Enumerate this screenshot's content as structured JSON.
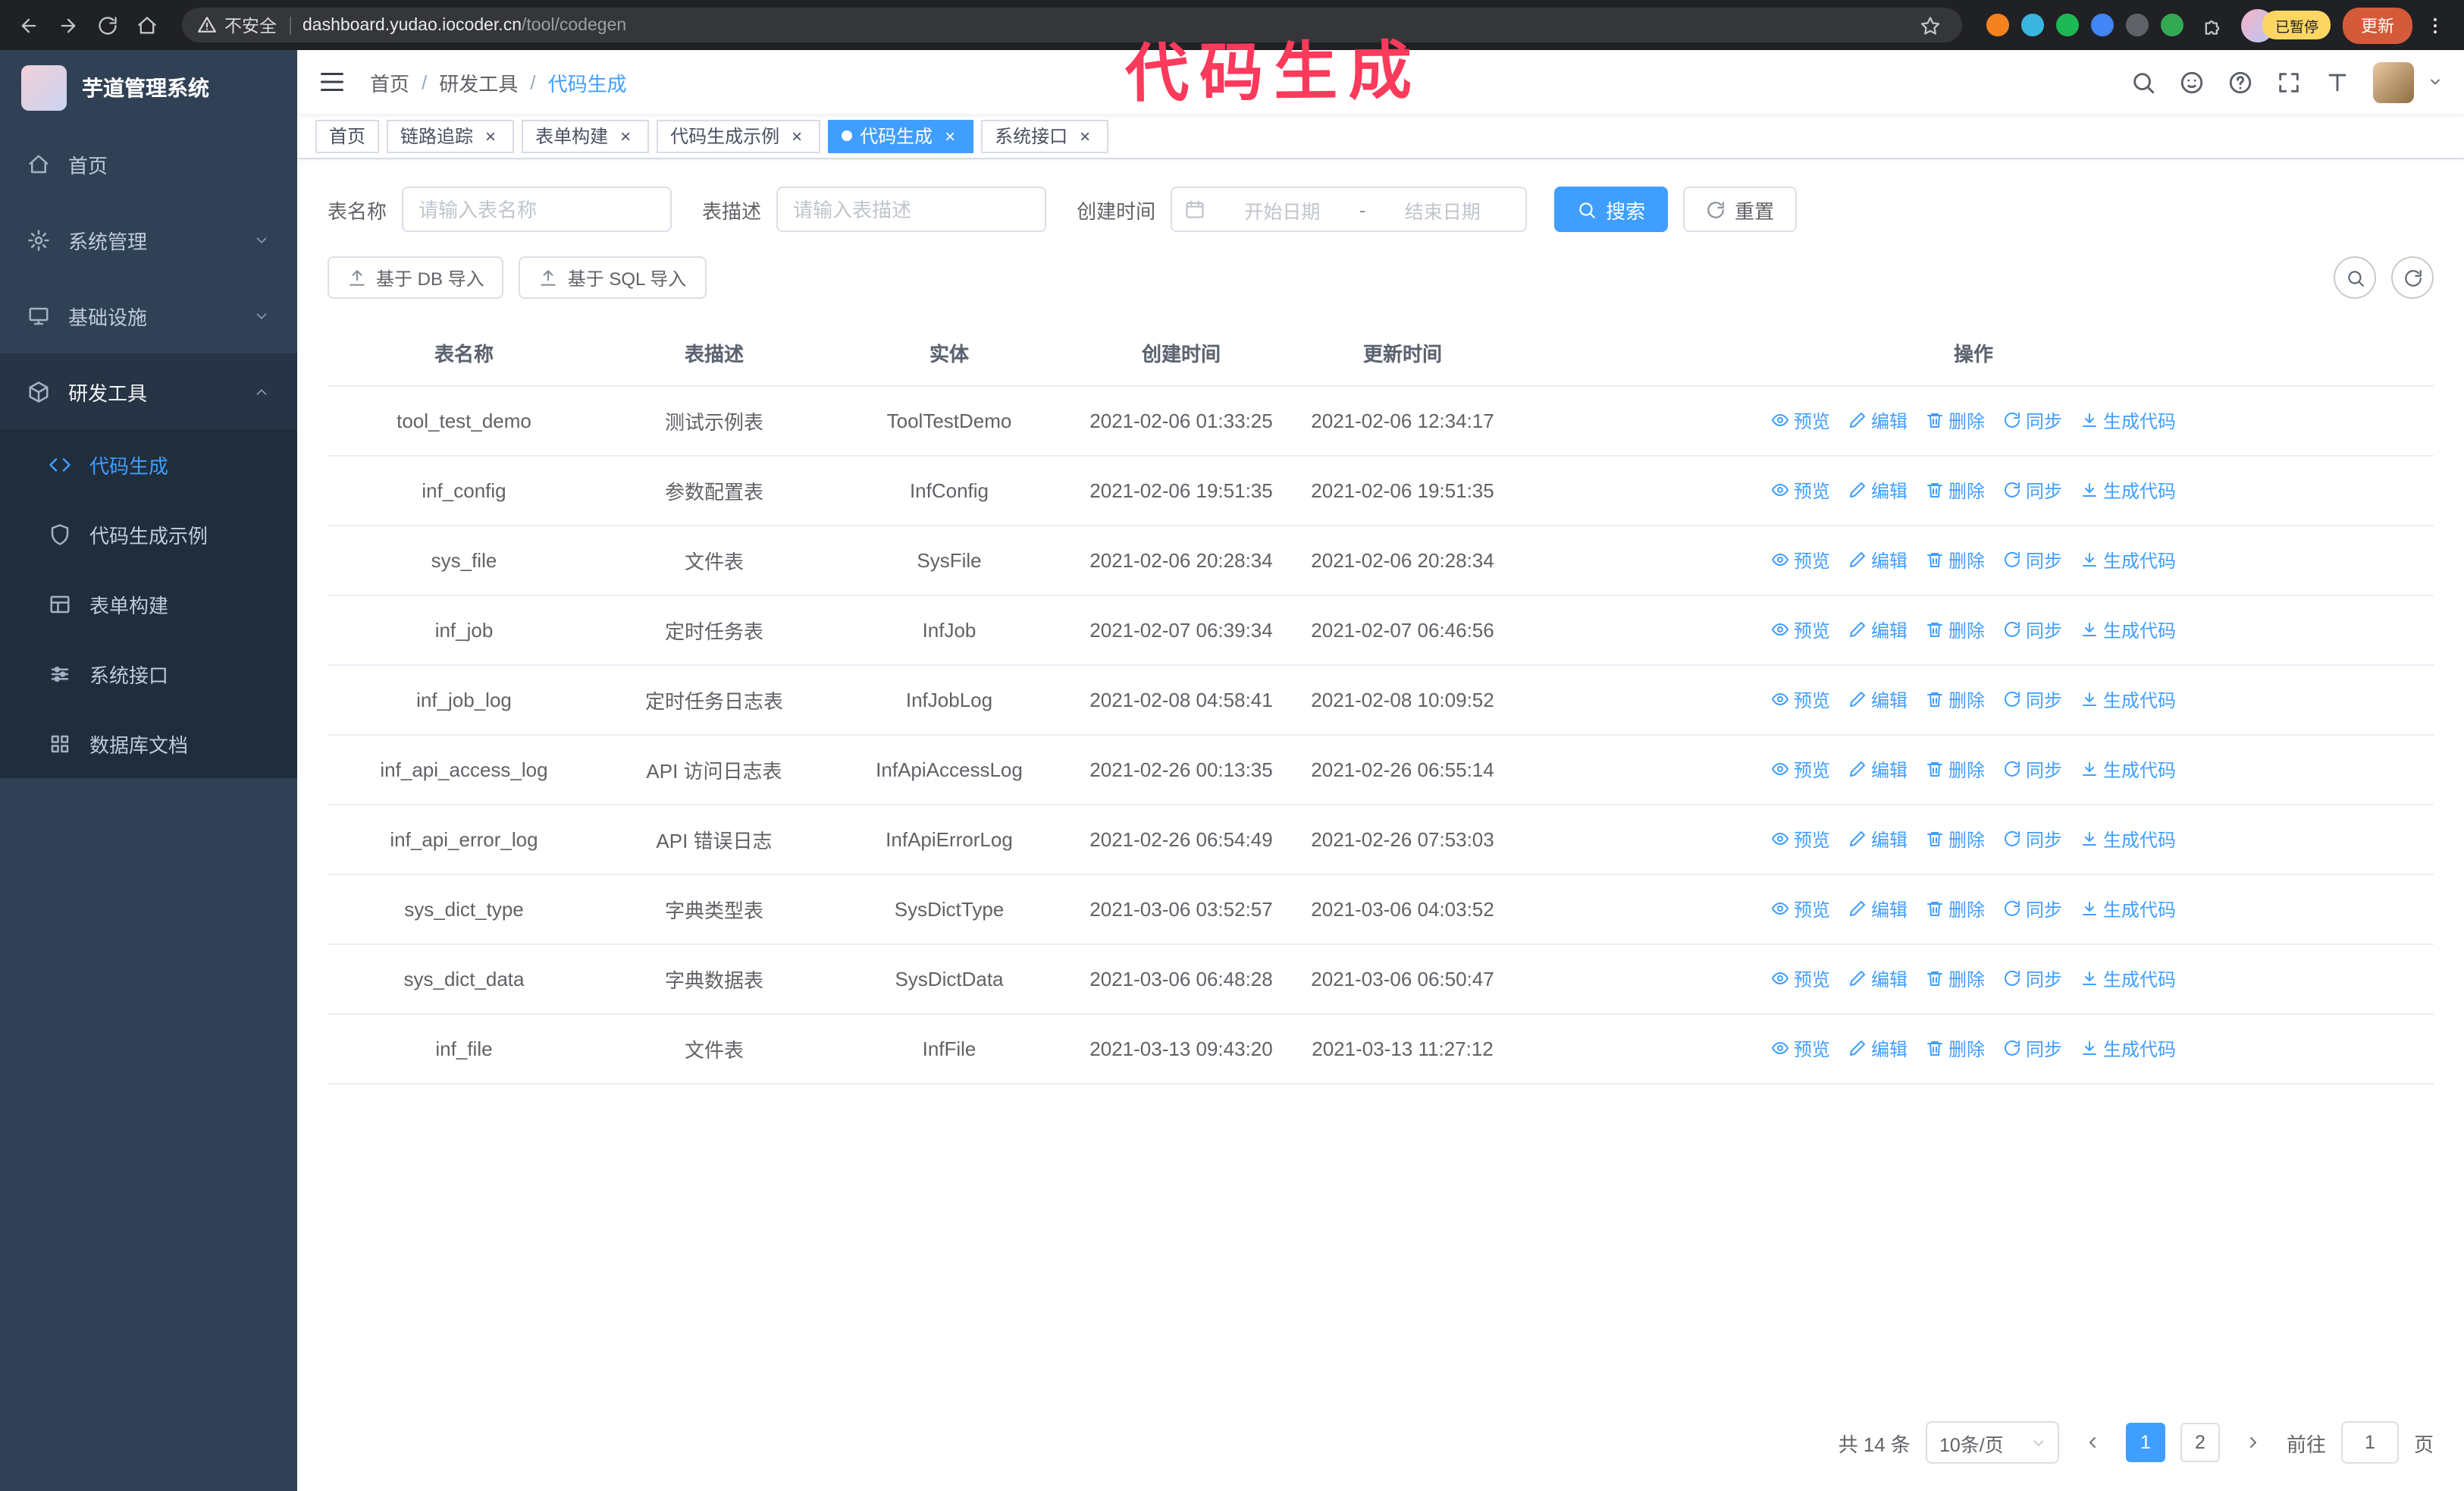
{
  "browser": {
    "security_label": "不安全",
    "url_host": "dashboard.yudao.iocoder.cn",
    "url_path": "/tool/codegen",
    "profile_badge": "已暂停",
    "update_label": "更新",
    "extension_colors": [
      "#f6821f",
      "#39b5e0",
      "#1db954",
      "#4285f4",
      "#5f6368",
      "#34a853"
    ]
  },
  "annotation": {
    "text": "代码生成",
    "color": "#fb3a5c"
  },
  "sidebar": {
    "logo_title": "芋道管理系统",
    "items": [
      {
        "key": "home",
        "icon": "home",
        "label": "首页"
      },
      {
        "key": "system-mgmt",
        "icon": "gear",
        "label": "系统管理",
        "expandable": true
      },
      {
        "key": "infrastructure",
        "icon": "monitor",
        "label": "基础设施",
        "expandable": true
      },
      {
        "key": "dev-tools",
        "icon": "cube",
        "label": "研发工具",
        "expandable": true,
        "expanded": true,
        "children": [
          {
            "key": "codegen",
            "icon": "code",
            "label": "代码生成",
            "active": true
          },
          {
            "key": "codegen-demo",
            "icon": "shield",
            "label": "代码生成示例"
          },
          {
            "key": "form-builder",
            "icon": "table",
            "label": "表单构建"
          },
          {
            "key": "system-api",
            "icon": "sliders",
            "label": "系统接口"
          },
          {
            "key": "db-doc",
            "icon": "grid",
            "label": "数据库文档"
          }
        ]
      }
    ]
  },
  "header": {
    "breadcrumb": [
      "首页",
      "研发工具",
      "代码生成"
    ],
    "separator": "/"
  },
  "tabs": [
    {
      "key": "home",
      "label": "首页",
      "closable": false
    },
    {
      "key": "tracing",
      "label": "链路追踪",
      "closable": true
    },
    {
      "key": "form-builder",
      "label": "表单构建",
      "closable": true
    },
    {
      "key": "codegen-demo",
      "label": "代码生成示例",
      "closable": true
    },
    {
      "key": "codegen",
      "label": "代码生成",
      "closable": true,
      "active": true
    },
    {
      "key": "system-api",
      "label": "系统接口",
      "closable": true
    }
  ],
  "filters": {
    "table_name_label": "表名称",
    "table_name_placeholder": "请输入表名称",
    "table_desc_label": "表描述",
    "table_desc_placeholder": "请输入表描述",
    "create_time_label": "创建时间",
    "date_start_placeholder": "开始日期",
    "date_separator": "-",
    "date_end_placeholder": "结束日期",
    "search_label": "搜索",
    "reset_label": "重置"
  },
  "toolbar": {
    "import_db": "基于 DB 导入",
    "import_sql": "基于 SQL 导入"
  },
  "table": {
    "columns": [
      "表名称",
      "表描述",
      "实体",
      "创建时间",
      "更新时间",
      "操作"
    ],
    "actions": [
      {
        "key": "preview",
        "icon": "eye",
        "label": "预览"
      },
      {
        "key": "edit",
        "icon": "pen",
        "label": "编辑"
      },
      {
        "key": "delete",
        "icon": "trash",
        "label": "删除"
      },
      {
        "key": "sync",
        "icon": "sync",
        "label": "同步"
      },
      {
        "key": "generate",
        "icon": "download",
        "label": "生成代码"
      }
    ],
    "rows": [
      {
        "name": "tool_test_demo",
        "desc": "测试示例表",
        "entity": "ToolTestDemo",
        "created": "2021-02-06 01:33:25",
        "updated": "2021-02-06 12:34:17"
      },
      {
        "name": "inf_config",
        "desc": "参数配置表",
        "entity": "InfConfig",
        "created": "2021-02-06 19:51:35",
        "updated": "2021-02-06 19:51:35"
      },
      {
        "name": "sys_file",
        "desc": "文件表",
        "entity": "SysFile",
        "created": "2021-02-06 20:28:34",
        "updated": "2021-02-06 20:28:34"
      },
      {
        "name": "inf_job",
        "desc": "定时任务表",
        "entity": "InfJob",
        "created": "2021-02-07 06:39:34",
        "updated": "2021-02-07 06:46:56"
      },
      {
        "name": "inf_job_log",
        "desc": "定时任务日志表",
        "entity": "InfJobLog",
        "created": "2021-02-08 04:58:41",
        "updated": "2021-02-08 10:09:52"
      },
      {
        "name": "inf_api_access_log",
        "desc": "API 访问日志表",
        "entity": "InfApiAccessLog",
        "created": "2021-02-26 00:13:35",
        "updated": "2021-02-26 06:55:14"
      },
      {
        "name": "inf_api_error_log",
        "desc": "API 错误日志",
        "entity": "InfApiErrorLog",
        "created": "2021-02-26 06:54:49",
        "updated": "2021-02-26 07:53:03"
      },
      {
        "name": "sys_dict_type",
        "desc": "字典类型表",
        "entity": "SysDictType",
        "created": "2021-03-06 03:52:57",
        "updated": "2021-03-06 04:03:52"
      },
      {
        "name": "sys_dict_data",
        "desc": "字典数据表",
        "entity": "SysDictData",
        "created": "2021-03-06 06:48:28",
        "updated": "2021-03-06 06:50:47"
      },
      {
        "name": "inf_file",
        "desc": "文件表",
        "entity": "InfFile",
        "created": "2021-03-13 09:43:20",
        "updated": "2021-03-13 11:27:12"
      }
    ]
  },
  "pagination": {
    "total": "共 14 条",
    "page_size": "10条/页",
    "pages": [
      "1",
      "2"
    ],
    "active_page": "1",
    "goto_label": "前往",
    "goto_value": "1",
    "goto_suffix": "页"
  }
}
